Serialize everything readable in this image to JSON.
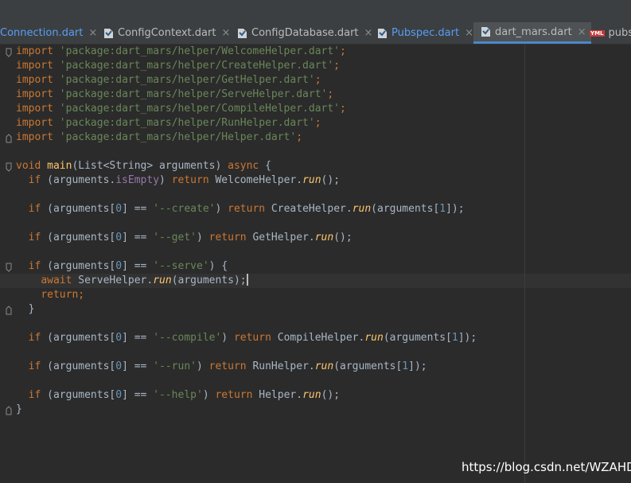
{
  "tabs": [
    {
      "label": "Connection.dart",
      "color": "#589df6"
    },
    {
      "label": "ConfigContext.dart"
    },
    {
      "label": "ConfigDatabase.dart"
    },
    {
      "label": "Pubspec.dart",
      "color": "#589df6"
    },
    {
      "label": "dart_mars.dart",
      "active": true
    },
    {
      "label": "pubspec.yaml",
      "icon": "yml-file-icon",
      "badge": "YML"
    }
  ],
  "tab_close_glyph": "×",
  "code": {
    "imports": [
      {
        "kw": "import",
        "str": "'package:dart_mars/helper/WelcomeHelper.dart'",
        "end": ";"
      },
      {
        "kw": "import",
        "str": "'package:dart_mars/helper/CreateHelper.dart'",
        "end": ";"
      },
      {
        "kw": "import",
        "str": "'package:dart_mars/helper/GetHelper.dart'",
        "end": ";"
      },
      {
        "kw": "import",
        "str": "'package:dart_mars/helper/ServeHelper.dart'",
        "end": ";"
      },
      {
        "kw": "import",
        "str": "'package:dart_mars/helper/CompileHelper.dart'",
        "end": ";"
      },
      {
        "kw": "import",
        "str": "'package:dart_mars/helper/RunHelper.dart'",
        "end": ";"
      },
      {
        "kw": "import",
        "str": "'package:dart_mars/helper/Helper.dart'",
        "end": ";"
      }
    ],
    "main_sig": {
      "kw_void": "void",
      "name": "main",
      "params": "(List<String> arguments) ",
      "kw_async": "async",
      "open": " {"
    },
    "line_empty_check": {
      "kw_if": "if",
      "open": " (arguments.",
      "prop": "isEmpty",
      "close": ") ",
      "kw_return": "return",
      "cls": " WelcomeHelper.",
      "method": "run",
      "end": "();"
    },
    "branches": [
      {
        "str": "'--create'",
        "cls": " CreateHelper.",
        "args": "(arguments[",
        "idx": "1",
        "end": "]);"
      },
      {
        "str": "'--get'",
        "cls": " GetHelper.",
        "args": "();"
      },
      {
        "str": "'--compile'",
        "cls": " CompileHelper.",
        "args": "(arguments[",
        "idx": "1",
        "end": "]);"
      },
      {
        "str": "'--run'",
        "cls": " RunHelper.",
        "args": "(arguments[",
        "idx": "1",
        "end": "]);"
      },
      {
        "str": "'--help'",
        "cls": " Helper.",
        "args": "();"
      }
    ],
    "serve_block": {
      "str": "'--serve'",
      "await_kw": "await",
      "await_rest": " ServeHelper.",
      "method": "run",
      "await_args": "(arguments);",
      "return_kw": "return",
      "return_end": ";"
    },
    "tokens": {
      "if": "if",
      "cond_open": " (arguments[",
      "zero": "0",
      "cond_eq": "] == ",
      "cond_close": ") ",
      "return": "return",
      "run": "run",
      "brace_open": "{",
      "brace_close": "}",
      "indent1": "  ",
      "indent2": "    "
    }
  },
  "watermark": "https://blog.csdn.net/WZAHD"
}
